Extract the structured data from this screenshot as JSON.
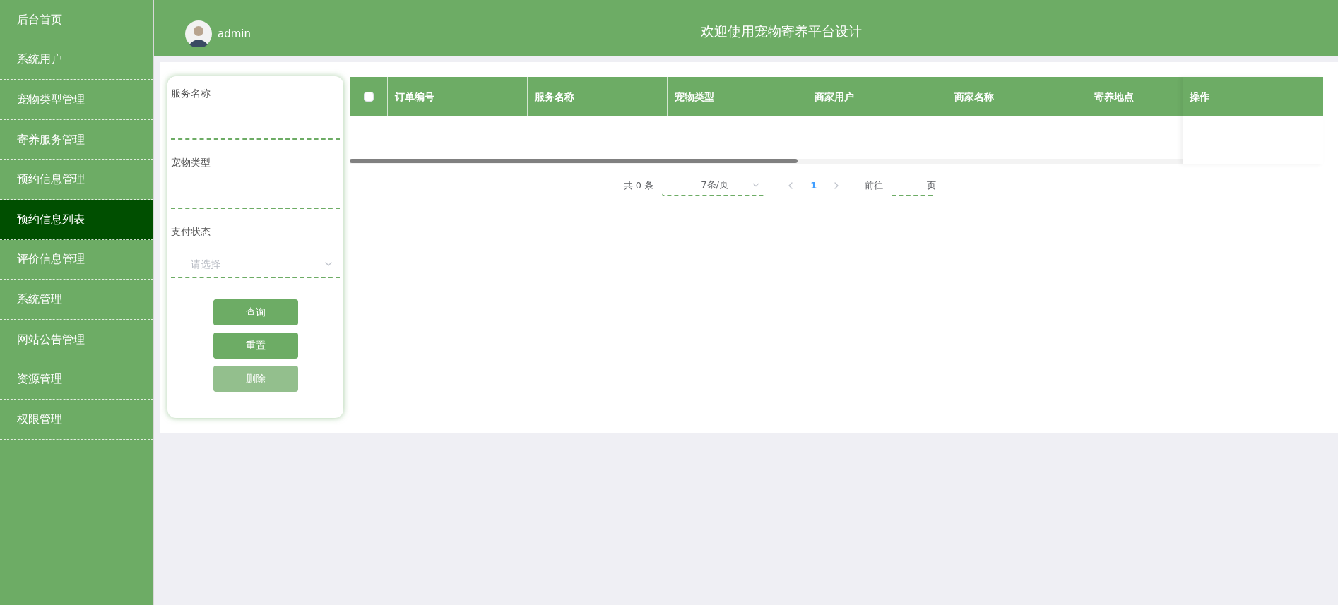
{
  "sidebar": {
    "items": [
      {
        "label": "后台首页",
        "selected": false
      },
      {
        "label": "系统用户",
        "selected": false
      },
      {
        "label": "宠物类型管理",
        "selected": false
      },
      {
        "label": "寄养服务管理",
        "selected": false
      },
      {
        "label": "预约信息管理",
        "selected": false
      },
      {
        "label": "预约信息列表",
        "selected": true
      },
      {
        "label": "评价信息管理",
        "selected": false
      },
      {
        "label": "系统管理",
        "selected": false
      },
      {
        "label": "网站公告管理",
        "selected": false
      },
      {
        "label": "资源管理",
        "selected": false
      },
      {
        "label": "权限管理",
        "selected": false
      }
    ]
  },
  "header": {
    "user": "admin",
    "title": "欢迎使用宠物寄养平台设计"
  },
  "filter": {
    "fields": [
      {
        "kind": "input",
        "label": "服务名称"
      },
      {
        "kind": "input",
        "label": "宠物类型"
      },
      {
        "kind": "select",
        "label": "支付状态",
        "placeholder": "请选择"
      }
    ],
    "buttons": [
      {
        "label": "查询",
        "disabled": false
      },
      {
        "label": "重置",
        "disabled": false
      },
      {
        "label": "删除",
        "disabled": true
      }
    ]
  },
  "table": {
    "select_all": {
      "checked": false
    },
    "columns": [
      "订单编号",
      "服务名称",
      "宠物类型",
      "商家用户",
      "商家名称",
      "寄养地点"
    ],
    "action_column": "操作"
  },
  "pagination": {
    "total": "共 0 条",
    "page_size": "7条/页",
    "pages": [
      {
        "label": "1",
        "selected": true
      }
    ],
    "goto": "前往",
    "page_suffix": "页"
  }
}
